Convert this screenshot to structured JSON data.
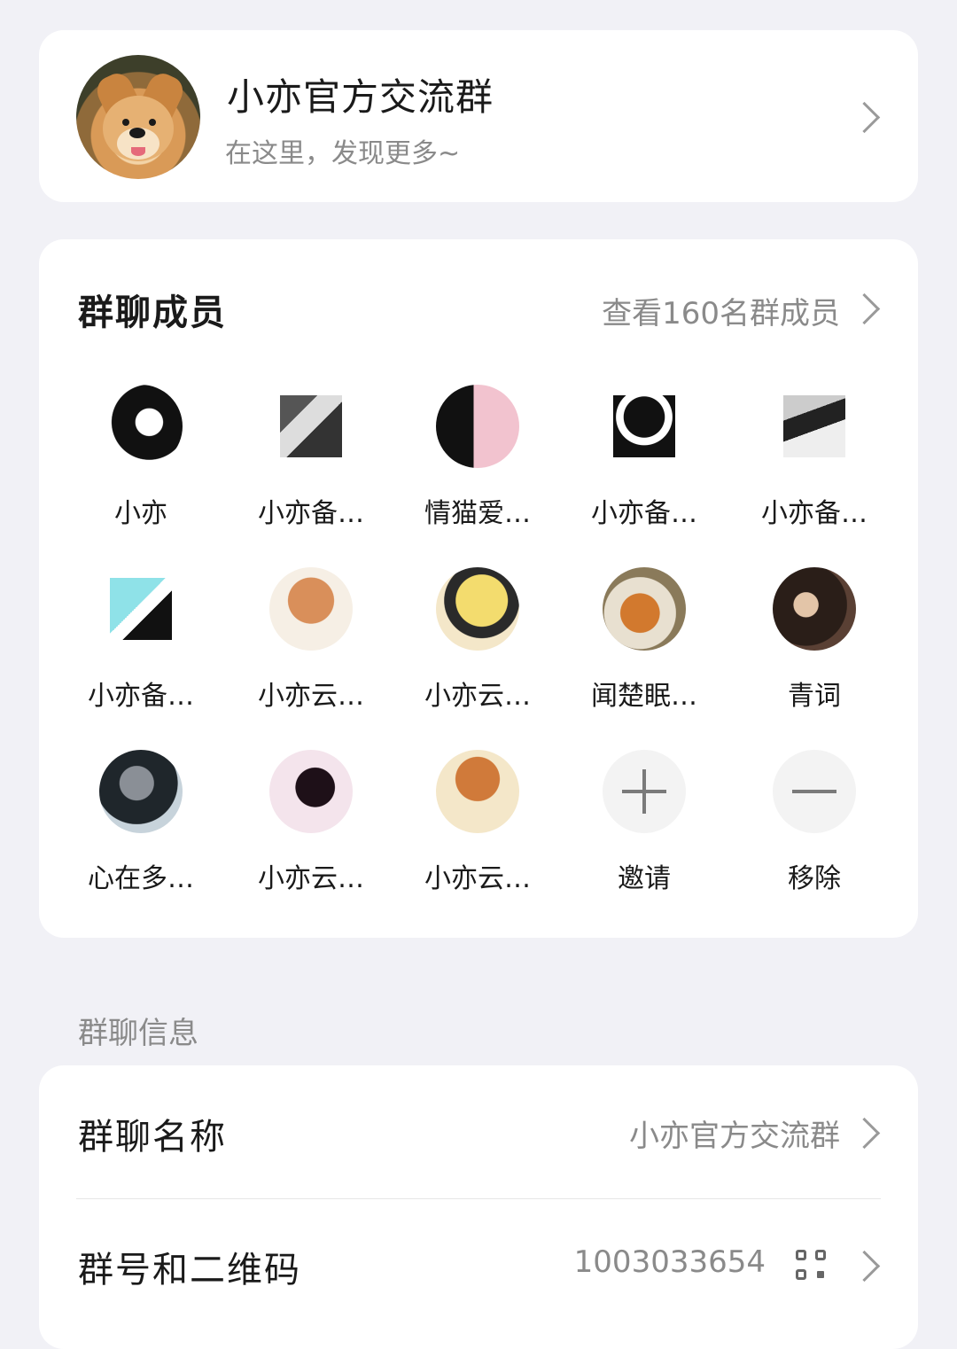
{
  "group": {
    "name": "小亦官方交流群",
    "description": "在这里，发现更多~"
  },
  "members": {
    "title": "群聊成员",
    "view_all": "查看160名群成员",
    "list": [
      {
        "name": "小亦"
      },
      {
        "name": "小亦备…"
      },
      {
        "name": "情猫爱…"
      },
      {
        "name": "小亦备…"
      },
      {
        "name": "小亦备…"
      },
      {
        "name": "小亦备…"
      },
      {
        "name": "小亦云…"
      },
      {
        "name": "小亦云…"
      },
      {
        "name": "闻楚眠…"
      },
      {
        "name": "青词"
      },
      {
        "name": "心在多…"
      },
      {
        "name": "小亦云…"
      },
      {
        "name": "小亦云…"
      }
    ],
    "invite_label": "邀请",
    "remove_label": "移除"
  },
  "info_section": {
    "label": "群聊信息",
    "name_label": "群聊名称",
    "name_value": "小亦官方交流群",
    "number_label": "群号和二维码",
    "number_value": "1003033654"
  }
}
